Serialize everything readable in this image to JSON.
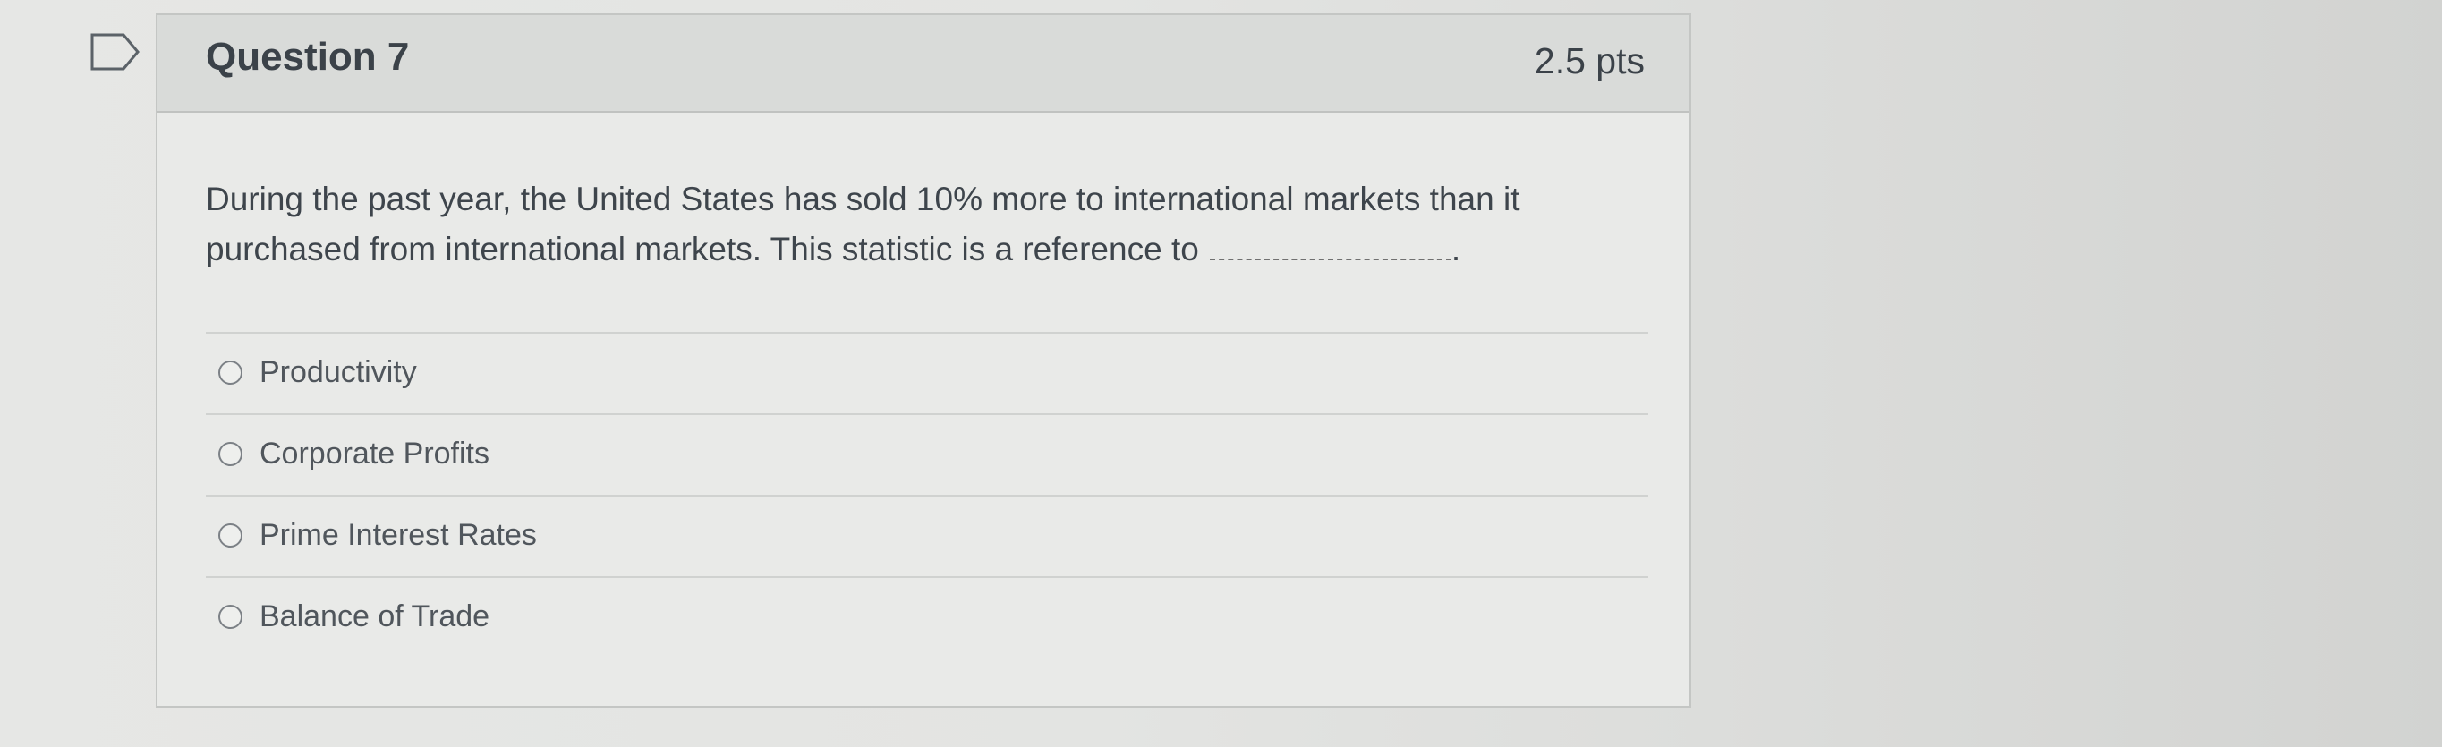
{
  "question": {
    "title": "Question 7",
    "points": "2.5 pts",
    "text": "During the past year, the United States has sold 10% more to international markets than it purchased from international markets. This statistic is a reference to",
    "text_suffix": ".",
    "flag_icon": "bookmark-flag-icon"
  },
  "answers": [
    {
      "label": "Productivity",
      "selected": false
    },
    {
      "label": "Corporate Profits",
      "selected": false
    },
    {
      "label": "Prime Interest Rates",
      "selected": false
    },
    {
      "label": "Balance of Trade",
      "selected": false
    }
  ]
}
